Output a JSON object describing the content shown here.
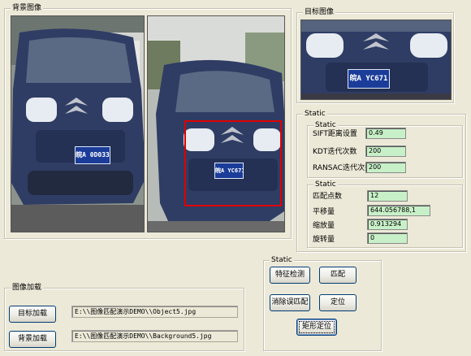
{
  "groups": {
    "background_image": "背景图像",
    "target_image": "目标图像",
    "static_outer": "Static",
    "static_params": "Static",
    "static_results": "Static",
    "image_loading": "图像加载",
    "static_actions": "Static"
  },
  "photos": {
    "left_plate": "皖A 0D033",
    "right_plate": "皖A YC671",
    "target_plate": "皖A YC671"
  },
  "params": {
    "sift_label": "SIFT距离设置",
    "sift_value": "0.49",
    "kdt_label": "KDT迭代次数",
    "kdt_value": "200",
    "ransac_label": "RANSAC迭代次数",
    "ransac_value": "200"
  },
  "results": {
    "match_label": "匹配点数",
    "match_value": "12",
    "translation_label": "平移量",
    "translation_value": "644.056788,1",
    "scale_label": "缩放量",
    "scale_value": "0.913294",
    "rotation_label": "旋转量",
    "rotation_value": "0"
  },
  "loading": {
    "load_target_button": "目标加载",
    "target_path": "E:\\\\图像匹配演示DEMO\\\\Object5.jpg",
    "load_background_button": "背景加载",
    "background_path": "E:\\\\图像匹配演示DEMO\\\\Background5.jpg"
  },
  "actions": {
    "feature_detect": "特征检测",
    "match": "匹配",
    "remove_mismatch": "消除误匹配",
    "locate": "定位",
    "rect_locate": "矩形定位"
  },
  "colors": {
    "dialog_bg": "#ece9d8",
    "value_bg": "#c8f0c8",
    "selection_rect": "#e00000",
    "car_body": "#2f3d64",
    "plate_bg": "#1b3d99"
  }
}
